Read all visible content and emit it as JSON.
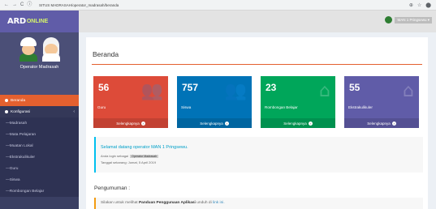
{
  "browser": {
    "back": "←",
    "forward": "→",
    "reload": "C",
    "info": "ⓘ",
    "url": "SITUS MADRASAH/operator_madrasah/beranda",
    "zoom": "⊕",
    "star": "☆",
    "account": "⬤"
  },
  "header": {
    "logo_main": "ARD",
    "logo_sub": "ONLINE",
    "user_name": "MAN 1 Pringsewu ▾"
  },
  "sidebar": {
    "profile_name": "Operator Madrasah",
    "beranda": "Beranda",
    "konfigurasi": "Konfigurasi",
    "caret": "‹",
    "sub_items": [
      "Madrasah",
      "Mata Pelajaran",
      "Muatan Lokal",
      "Ekstrakulikuler",
      "Guru",
      "Siswa",
      "Rombongan Belajar"
    ]
  },
  "main": {
    "title": "Beranda",
    "boxes": [
      {
        "value": "56",
        "label": "Guru",
        "more": "Selengkapnya",
        "color": "#dd4b39",
        "icon": "users-icon"
      },
      {
        "value": "757",
        "label": "Siswa",
        "more": "Selengkapnya",
        "color": "#0073b7",
        "icon": "users-icon"
      },
      {
        "value": "23",
        "label": "Rombongan Belajar",
        "more": "Selengkapnya",
        "color": "#00a65a",
        "icon": "home-icon"
      },
      {
        "value": "55",
        "label": "Ekstrakulikuler",
        "more": "Selengkapnya",
        "color": "#605ca8",
        "icon": "home-icon"
      }
    ],
    "welcome": {
      "heading": "Selamat datang operator MAN 1 Pringsewu.",
      "login_prefix": "Anda login sebagai",
      "login_role": "Operator Madrasah",
      "date": "Tanggal sekarang: Jumat, 5 April 2019"
    },
    "pengumuman_title": "Pengumuman :",
    "notice": {
      "prefix": "Silakan untuk melihat",
      "bold": "Panduan Penggunaan Aplikasi",
      "middle": "unduh di",
      "link": "link ini."
    }
  }
}
